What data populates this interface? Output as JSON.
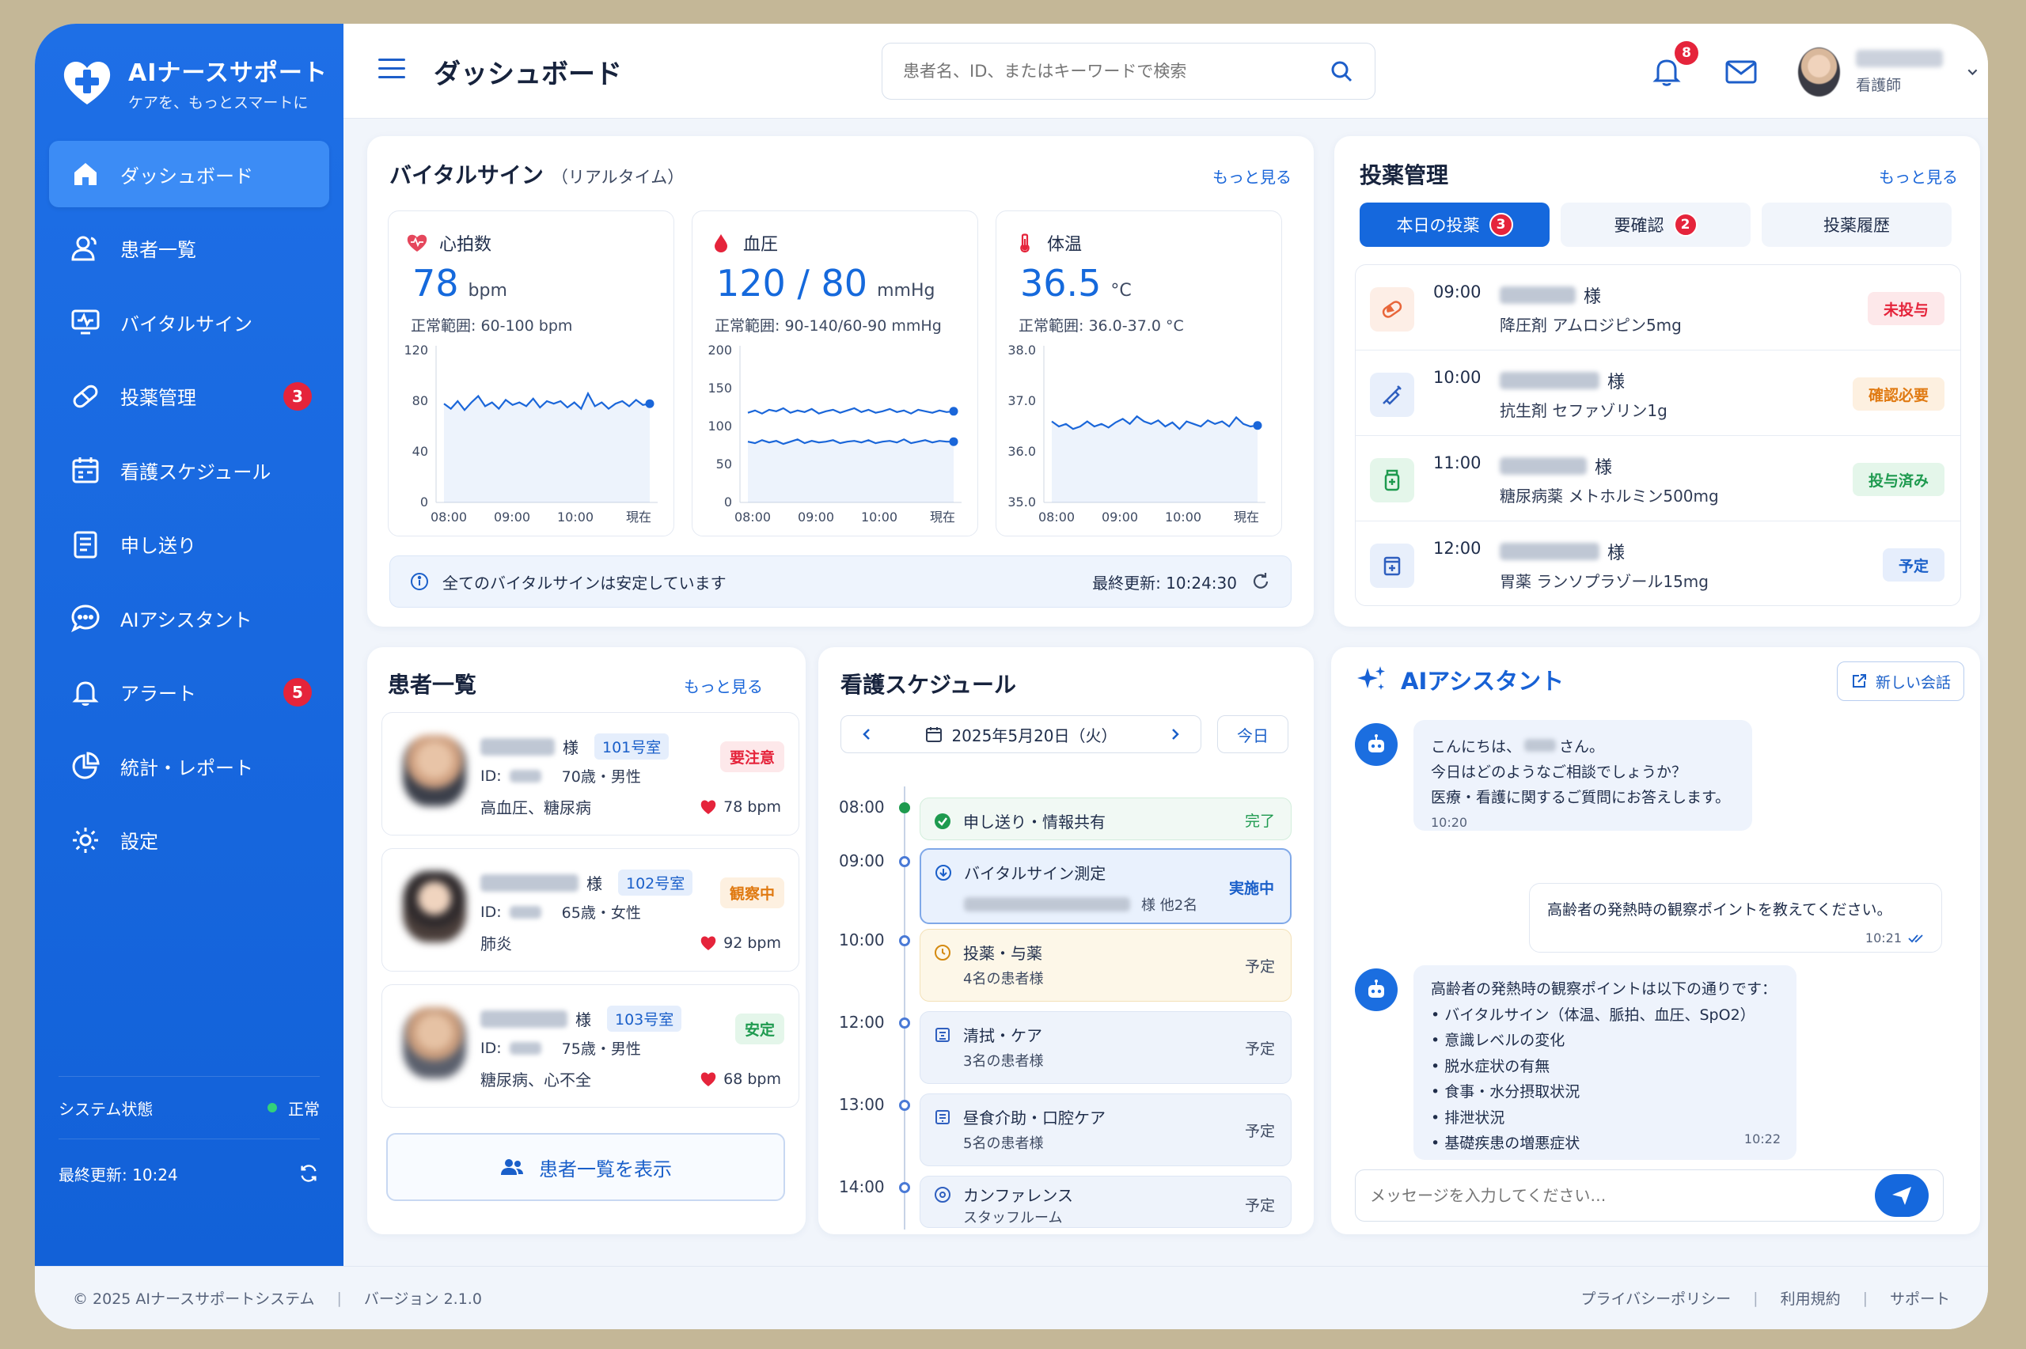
{
  "brand": {
    "title": "AIナースサポート",
    "subtitle": "ケアを、もっとスマートに"
  },
  "sidebar": {
    "items": [
      {
        "label": "ダッシュボード",
        "icon": "home-icon",
        "active": true
      },
      {
        "label": "患者一覧",
        "icon": "users-icon"
      },
      {
        "label": "バイタルサイン",
        "icon": "monitor-icon"
      },
      {
        "label": "投薬管理",
        "icon": "pill-icon",
        "badge": "3"
      },
      {
        "label": "看護スケジュール",
        "icon": "calendar-icon"
      },
      {
        "label": "申し送り",
        "icon": "document-icon"
      },
      {
        "label": "AIアシスタント",
        "icon": "chat-icon"
      },
      {
        "label": "アラート",
        "icon": "bell-icon",
        "badge": "5"
      },
      {
        "label": "統計・レポート",
        "icon": "pie-chart-icon"
      },
      {
        "label": "設定",
        "icon": "gear-icon"
      }
    ],
    "system_label": "システム状態",
    "system_status": "正常",
    "last_update": "最終更新: 10:24"
  },
  "header": {
    "title": "ダッシュボード",
    "search_placeholder": "患者名、ID、またはキーワードで検索",
    "notification_count": "8",
    "user_role": "看護師"
  },
  "vitals": {
    "title": "バイタルサイン",
    "subtitle": "（リアルタイム）",
    "more": "もっと見る",
    "cards": [
      {
        "label": "心拍数",
        "value": "78",
        "unit": "bpm",
        "range": "正常範囲: 60-100 bpm",
        "y_ticks": [
          "120",
          "80",
          "40",
          "0"
        ],
        "ylim": [
          0,
          120
        ],
        "x_ticks": [
          "08:00",
          "09:00",
          "10:00",
          "現在"
        ],
        "series": [
          [
            78,
            74,
            80,
            73,
            79,
            84,
            76,
            79,
            74,
            81,
            77,
            79,
            76,
            82,
            75,
            80,
            78,
            80,
            75,
            79,
            74,
            86,
            76,
            79,
            74,
            78,
            80,
            76,
            81,
            77,
            78
          ]
        ]
      },
      {
        "label": "血圧",
        "value": "120 / 80",
        "unit": "mmHg",
        "range": "正常範囲: 90-140/60-90 mmHg",
        "y_ticks": [
          "200",
          "150",
          "100",
          "50",
          "0"
        ],
        "ylim": [
          0,
          200
        ],
        "x_ticks": [
          "08:00",
          "09:00",
          "10:00",
          "現在"
        ],
        "series": [
          [
            118,
            121,
            117,
            122,
            120,
            124,
            118,
            121,
            119,
            123,
            117,
            120,
            122,
            118,
            121,
            124,
            119,
            122,
            118,
            120,
            123,
            119,
            121,
            117,
            122,
            120,
            118,
            121,
            119,
            120
          ],
          [
            80,
            78,
            82,
            79,
            81,
            77,
            80,
            83,
            78,
            81,
            79,
            80,
            82,
            78,
            80,
            81,
            79,
            82,
            78,
            80,
            81,
            79,
            83,
            78,
            80,
            82,
            79,
            81,
            80,
            80
          ]
        ]
      },
      {
        "label": "体温",
        "value": "36.5",
        "unit": "°C",
        "range": "正常範囲: 36.0-37.0 °C",
        "y_ticks": [
          "38.0",
          "37.0",
          "36.0",
          "35.0"
        ],
        "ylim": [
          35,
          38
        ],
        "x_ticks": [
          "08:00",
          "09:00",
          "10:00",
          "現在"
        ],
        "series": [
          [
            36.6,
            36.5,
            36.55,
            36.45,
            36.5,
            36.6,
            36.5,
            36.55,
            36.48,
            36.58,
            36.65,
            36.55,
            36.7,
            36.6,
            36.55,
            36.62,
            36.5,
            36.58,
            36.45,
            36.6,
            36.55,
            36.5,
            36.62,
            36.55,
            36.6,
            36.5,
            36.68,
            36.55,
            36.5,
            36.52
          ]
        ]
      }
    ],
    "note": "全てのバイタルサインは安定しています",
    "last_update": "最終更新: 10:24:30"
  },
  "medication": {
    "title": "投薬管理",
    "more": "もっと見る",
    "tabs": [
      {
        "label": "本日の投薬",
        "badge": "3",
        "active": true
      },
      {
        "label": "要確認",
        "badge": "2"
      },
      {
        "label": "投薬履歴"
      }
    ],
    "rows": [
      {
        "time": "09:00",
        "suffix": "様",
        "drug": "降圧剤 アムロジピン5mg",
        "status": "未投与",
        "status_color": "#e5243b",
        "status_bg": "#fde8ea",
        "icon": "pill-icon",
        "icon_color": "#e8663a",
        "icon_bg": "#fdeee6"
      },
      {
        "time": "10:00",
        "suffix": "様",
        "drug": "抗生剤 セファゾリン1g",
        "status": "確認必要",
        "status_color": "#e07a12",
        "status_bg": "#fdf0e0",
        "icon": "syringe-icon",
        "icon_color": "#2f5fbf",
        "icon_bg": "#e8effb"
      },
      {
        "time": "11:00",
        "suffix": "様",
        "drug": "糖尿病薬 メトホルミン500mg",
        "status": "投与済み",
        "status_color": "#1e9a4f",
        "status_bg": "#e4f6ea",
        "icon": "medicine-bottle-icon",
        "icon_color": "#1e9a4f",
        "icon_bg": "#e4f6ea"
      },
      {
        "time": "12:00",
        "suffix": "様",
        "drug": "胃薬 ランソプラゾール15mg",
        "status": "予定",
        "status_color": "#1a5fc9",
        "status_bg": "#e6eefc",
        "icon": "medicine-box-icon",
        "icon_color": "#2f5fbf",
        "icon_bg": "#e8effb"
      }
    ]
  },
  "patients": {
    "title": "患者一覧",
    "more": "もっと見る",
    "items": [
      {
        "suffix": "様",
        "room": "101号室",
        "id_label": "ID:",
        "age_sex": "70歳・男性",
        "dx": "高血圧、糖尿病",
        "status": "要注意",
        "status_color": "#e5243b",
        "status_bg": "#fde8ea",
        "bpm": "78 bpm"
      },
      {
        "suffix": "様",
        "room": "102号室",
        "id_label": "ID:",
        "age_sex": "65歳・女性",
        "dx": "肺炎",
        "status": "観察中",
        "status_color": "#e07a12",
        "status_bg": "#fdf0e0",
        "bpm": "92 bpm"
      },
      {
        "suffix": "様",
        "room": "103号室",
        "id_label": "ID:",
        "age_sex": "75歳・男性",
        "dx": "糖尿病、心不全",
        "status": "安定",
        "status_color": "#1e9a4f",
        "status_bg": "#e4f6ea",
        "bpm": "68 bpm"
      }
    ],
    "show_all": "患者一覧を表示"
  },
  "schedule": {
    "title": "看護スケジュール",
    "date": "2025年5月20日（火）",
    "today": "今日",
    "times": [
      "08:00",
      "09:00",
      "10:00",
      "12:00",
      "13:00",
      "14:00"
    ],
    "items": [
      {
        "title": "申し送り・情報共有",
        "sub": "",
        "state": "完了",
        "state_color": "#1e9a4f",
        "icon": "check-circle-icon"
      },
      {
        "title": "バイタルサイン測定",
        "sub": "様 他2名",
        "state": "実施中",
        "state_color": "#1a5fc9",
        "icon": "arrow-circle-icon"
      },
      {
        "title": "投薬・与薬",
        "sub": "4名の患者様",
        "state": "予定",
        "state_color": "#3e4a62",
        "icon": "clock-icon"
      },
      {
        "title": "清拭・ケア",
        "sub": "3名の患者様",
        "state": "予定",
        "state_color": "#3e4a62",
        "icon": "care-icon"
      },
      {
        "title": "昼食介助・口腔ケア",
        "sub": "5名の患者様",
        "state": "予定",
        "state_color": "#3e4a62",
        "icon": "meal-icon"
      },
      {
        "title": "カンファレンス",
        "sub": "スタッフルーム",
        "state": "予定",
        "state_color": "#3e4a62",
        "icon": "meeting-icon"
      }
    ]
  },
  "ai": {
    "title": "AIアシスタント",
    "new_chat": "新しい会話",
    "msg1": {
      "l1a": "こんにちは、",
      "l1b": "さん。",
      "l2": "今日はどのようなご相談でしょうか？",
      "l3": "医療・看護に関するご質問にお答えします。",
      "time": "10:20"
    },
    "user_msg": {
      "text": "高齢者の発熱時の観察ポイントを教えてください。",
      "time": "10:21"
    },
    "msg2": {
      "intro": "高齢者の発熱時の観察ポイントは以下の通りです：",
      "points": [
        "• バイタルサイン（体温、脈拍、血圧、SpO2）",
        "• 意識レベルの変化",
        "• 脱水症状の有無",
        "• 食事・水分摂取状況",
        "• 排泄状況",
        "• 基礎疾患の増悪症状"
      ],
      "time": "10:22"
    },
    "input_placeholder": "メッセージを入力してください…"
  },
  "footer": {
    "copyright": "© 2025 AIナースサポートシステム",
    "version": "バージョン 2.1.0",
    "links": [
      "プライバシーポリシー",
      "利用規約",
      "サポート"
    ]
  }
}
